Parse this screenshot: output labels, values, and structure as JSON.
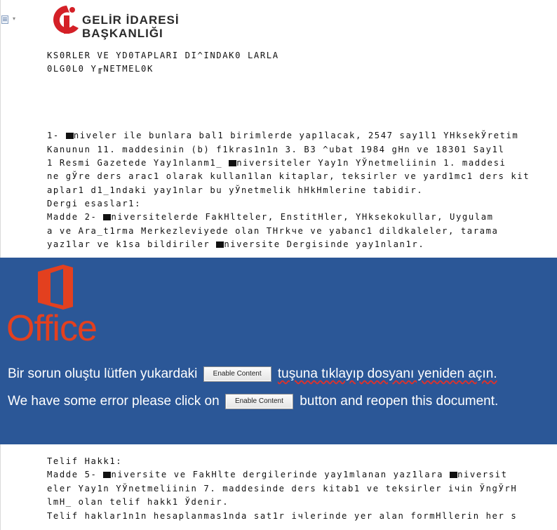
{
  "logo": {
    "line1": "GELİR İDARESİ",
    "line2": "BAŞKANLIĞI"
  },
  "document": {
    "title_lines": [
      "KS0RLER VE YD0TAPLARI DI^INDAK0 LARLA",
      "0LG0L0 Y╓NETMEL0K"
    ],
    "paragraphs": [
      {
        "pre": "1- ",
        "post": "niveler ile bunlara bal1 birimlerde yap1lacak, 2547 say1l1 YНksekЎretim"
      },
      {
        "pre": "Kanunun 11. maddesinin (b) f1kras1n1n 3. B3 ^ubat 1984 gНn ve 18301 Say1l"
      },
      {
        "pre": "1 Resmi Gazetede Yay1nlanm1_ ",
        "post": "niversiteler Yay1n YЎnetmeliinin 1. maddesi"
      },
      {
        "pre": "ne gЎre ders arac1 olarak kullan1lan kitaplar, teksirler ve yard1mc1 ders kit"
      },
      {
        "pre": "aplar1 d1_1ndaki yay1nlar bu yЎnetmelik hНkНmlerine tabidir."
      },
      {
        "pre": "Dergi esaslar1:"
      },
      {
        "pre": "Madde 2- ",
        "post": "niversitelerde FakНlteler, EnstitНler, YНksekokullar, Uygulam"
      },
      {
        "pre": "a ve Ara_t1rma Merkezleviyede olan TНrkчe ve yabanc1 dildkaleler, tarama"
      },
      {
        "pre": "yaz1lar ve k1sa bildiriler ",
        "post": "niversite Dergisinde yay1nlan1r."
      }
    ],
    "lower_paragraphs": [
      {
        "pre": "Telif Hakk1:"
      },
      {
        "pre": "Madde 5- ",
        "post": "niversite ve FakНlte dergilerinde yay1mlanan yaz1lara ",
        "post2": "niversit"
      },
      {
        "pre": "eler Yay1n YЎnetmeliinin 7. maddesinde ders kitab1 ve teksirler iчin ЎngЎrН"
      },
      {
        "pre": "lmН_ olan telif hakk1 Ўdenir."
      },
      {
        "pre": "Telif haklar1n1n hesaplanmas1nda sat1r iчlerinde yer alan formНllerin her s"
      }
    ]
  },
  "overlay": {
    "brand": "Office",
    "message_tr_before": "Bir sorun oluştu lütfen yukardaki",
    "message_tr_after": "tuşuna tıklayıp dosyanı yeniden açın.",
    "message_en_before": "We have some error please click on",
    "message_en_after": "button and reopen this document.",
    "button_label": "Enable Content"
  },
  "colors": {
    "overlay_bg": "#2b5797",
    "office_orange": "#e3401f",
    "logo_red": "#d42027"
  }
}
